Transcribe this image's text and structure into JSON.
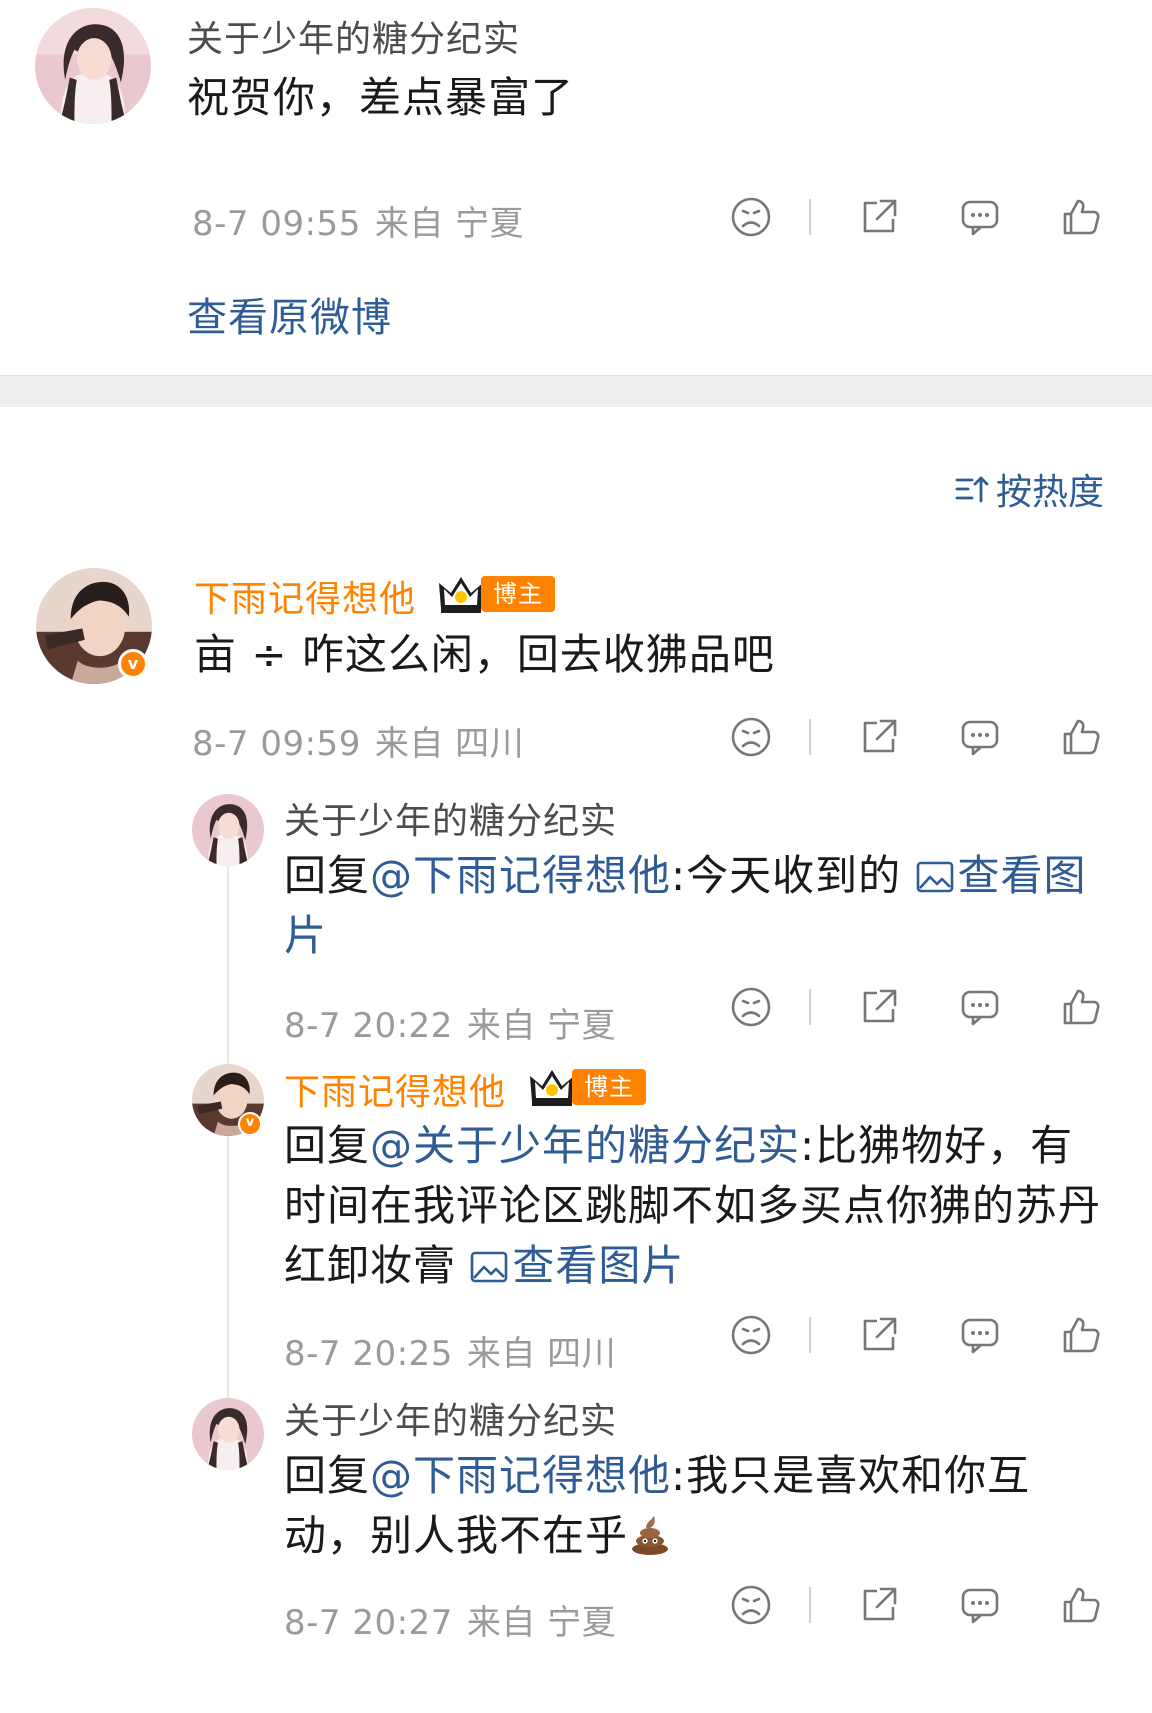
{
  "post": {
    "author": "关于少年的糖分纪实",
    "text": "祝贺你，差点暴富了",
    "time": "8-7 09:55",
    "source": "来自 宁夏",
    "view_original": "查看原微博"
  },
  "sort_label": "按热度",
  "comment": {
    "author": "下雨记得想他",
    "badge": "博主",
    "text": "亩 ÷ 咋这么闲，回去收狒品吧",
    "time": "8-7 09:59",
    "source": "来自 四川"
  },
  "replies": [
    {
      "author": "关于少年的糖分纪实",
      "prefix": "回复",
      "mention": "@下雨记得想他",
      "text": ":今天收到的 ",
      "pic_link": "查看图片",
      "time": "8-7 20:22",
      "source": "来自 宁夏"
    },
    {
      "author": "下雨记得想他",
      "badge": "博主",
      "prefix": "回复",
      "mention": "@关于少年的糖分纪实",
      "text": ":比狒物好，有时间在我评论区跳脚不如多买点你狒的苏丹红卸妆膏 ",
      "pic_link": "查看图片",
      "time": "8-7 20:25",
      "source": "来自 四川"
    },
    {
      "author": "关于少年的糖分纪实",
      "prefix": "回复",
      "mention": "@下雨记得想他",
      "text": ":我只是喜欢和你互动，别人我不在乎",
      "emoji": "poop-emoji",
      "time": "8-7 20:27",
      "source": "来自 宁夏"
    }
  ],
  "icons": {
    "dislike": "sad-face-icon",
    "share": "share-icon",
    "comment": "comment-icon",
    "like": "thumbs-up-icon",
    "sort": "sort-icon",
    "picture": "picture-icon",
    "verified": "verified-badge-icon",
    "crown": "crown-icon"
  },
  "colors": {
    "link": "#2f5c94",
    "orange": "#ff8200",
    "meta": "#9a9a9a",
    "band": "#eeeeee"
  },
  "verified_mark": "v"
}
